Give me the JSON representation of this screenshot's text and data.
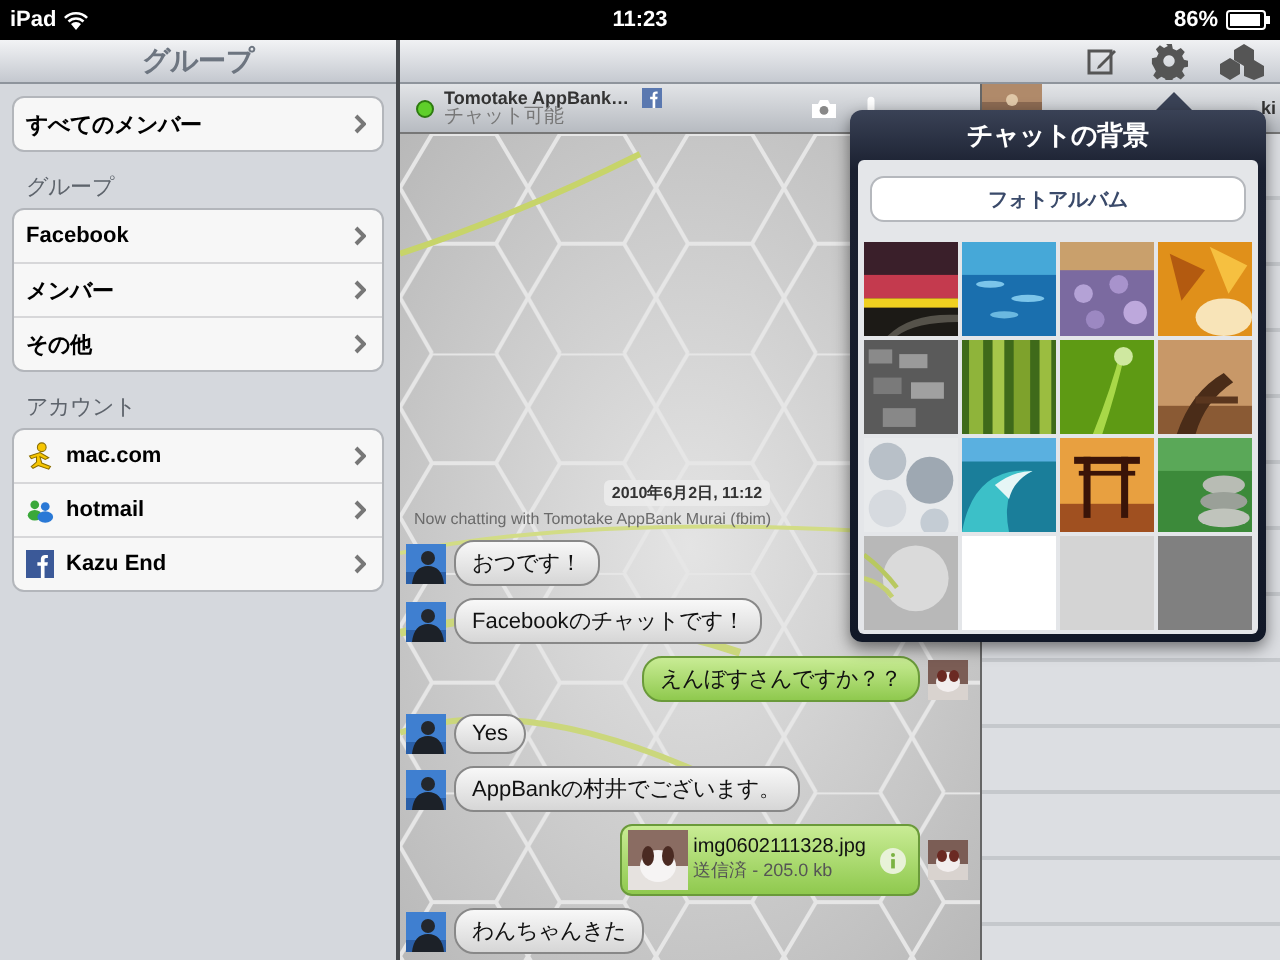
{
  "status_bar": {
    "carrier": "iPad",
    "time": "11:23",
    "battery": "86%"
  },
  "sidebar": {
    "title": "グループ",
    "sections": [
      {
        "items": [
          {
            "label": "すべてのメンバー"
          }
        ]
      },
      {
        "title": "グループ",
        "items": [
          {
            "label": "Facebook"
          },
          {
            "label": "メンバー"
          },
          {
            "label": "その他"
          }
        ]
      },
      {
        "title": "アカウント",
        "items": [
          {
            "label": "mac.com",
            "kind": "aim"
          },
          {
            "label": "hotmail",
            "kind": "messenger"
          },
          {
            "label": "Kazu End",
            "kind": "facebook"
          }
        ]
      }
    ]
  },
  "chat": {
    "contact": {
      "name": "Tomotake AppBank…",
      "kind": "facebook",
      "status": "チャット可能",
      "online": true
    },
    "timestamp": "2010年6月2日, 11:12",
    "notice": "Now chatting with Tomotake AppBank Murai (fbim)",
    "messages": [
      {
        "kind": "incoming",
        "text": "おつです！"
      },
      {
        "kind": "incoming",
        "text": "Facebookのチャットです！"
      },
      {
        "kind": "outgoing",
        "text": "えんぼすさんですか？？"
      },
      {
        "kind": "incoming",
        "text": "Yes"
      },
      {
        "kind": "incoming",
        "text": "AppBankの村井でございます。"
      },
      {
        "kind": "file",
        "text": "img0602111328.jpg",
        "detail": "送信済 - 205.0 kb"
      },
      {
        "kind": "incoming",
        "text": "わんちゃんきた"
      }
    ]
  },
  "buddy_list": {
    "name": "ki"
  },
  "popover": {
    "title": "チャットの背景",
    "button": "フォトアルバム",
    "backgrounds": [
      {
        "kind": "picture"
      },
      {
        "kind": "picture"
      },
      {
        "kind": "picture"
      },
      {
        "kind": "picture"
      },
      {
        "kind": "picture"
      },
      {
        "kind": "picture"
      },
      {
        "kind": "picture"
      },
      {
        "kind": "picture"
      },
      {
        "kind": "picture"
      },
      {
        "kind": "picture"
      },
      {
        "kind": "picture"
      },
      {
        "kind": "picture"
      },
      {
        "kind": "picture"
      },
      {
        "kind": "plain",
        "color": "#ffffff"
      },
      {
        "kind": "plain",
        "color": "#d4d4d4"
      },
      {
        "kind": "plain",
        "color": "#808080"
      }
    ]
  }
}
